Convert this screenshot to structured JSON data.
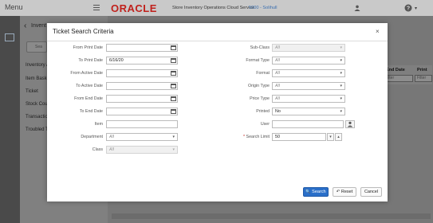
{
  "app": {
    "menu_label": "Menu",
    "brand": "ORACLE",
    "title": "Store Inventory Operations Cloud Service",
    "store": "5000 - Solihull"
  },
  "sidebar": {
    "header": "Invent",
    "search_placeholder": "Sea",
    "items": [
      {
        "label": "Inventory A"
      },
      {
        "label": "Item Baske"
      },
      {
        "label": "Ticket"
      },
      {
        "label": "Stock Coun"
      },
      {
        "label": "Transaction"
      },
      {
        "label": "Troubled Tr"
      }
    ]
  },
  "background_table": {
    "columns": [
      {
        "label": "End Date",
        "filter": "Filter"
      },
      {
        "label": "Print",
        "filter": "Filter"
      }
    ]
  },
  "dialog": {
    "title": "Ticket Search Criteria",
    "close_glyph": "×",
    "left_fields": {
      "from_print_date": {
        "label": "From Print Date",
        "value": ""
      },
      "to_print_date": {
        "label": "To Print Date",
        "value": "6/16/20"
      },
      "from_active_date": {
        "label": "From Active Date",
        "value": ""
      },
      "to_active_date": {
        "label": "To Active Date",
        "value": ""
      },
      "from_end_date": {
        "label": "From End Date",
        "value": ""
      },
      "to_end_date": {
        "label": "To End Date",
        "value": ""
      },
      "item": {
        "label": "Item",
        "value": ""
      },
      "department": {
        "label": "Department",
        "value": "All"
      },
      "class": {
        "label": "Class",
        "value": "All"
      }
    },
    "right_fields": {
      "sub_class": {
        "label": "Sub-Class",
        "value": "All"
      },
      "format_type": {
        "label": "Format Type",
        "value": "All"
      },
      "format": {
        "label": "Format",
        "value": "All"
      },
      "origin_type": {
        "label": "Origin Type",
        "value": "All"
      },
      "price_type": {
        "label": "Price Type",
        "value": "All"
      },
      "printed": {
        "label": "Printed",
        "value": "No"
      },
      "user": {
        "label": "User",
        "value": ""
      },
      "search_limit": {
        "label": "Search Limit",
        "value": "50",
        "required_mark": "*"
      }
    },
    "buttons": {
      "search": "Search",
      "reset": "Reset",
      "cancel": "Cancel"
    }
  },
  "colors": {
    "primary": "#2a6fc9",
    "brand_red": "#c0211c"
  }
}
